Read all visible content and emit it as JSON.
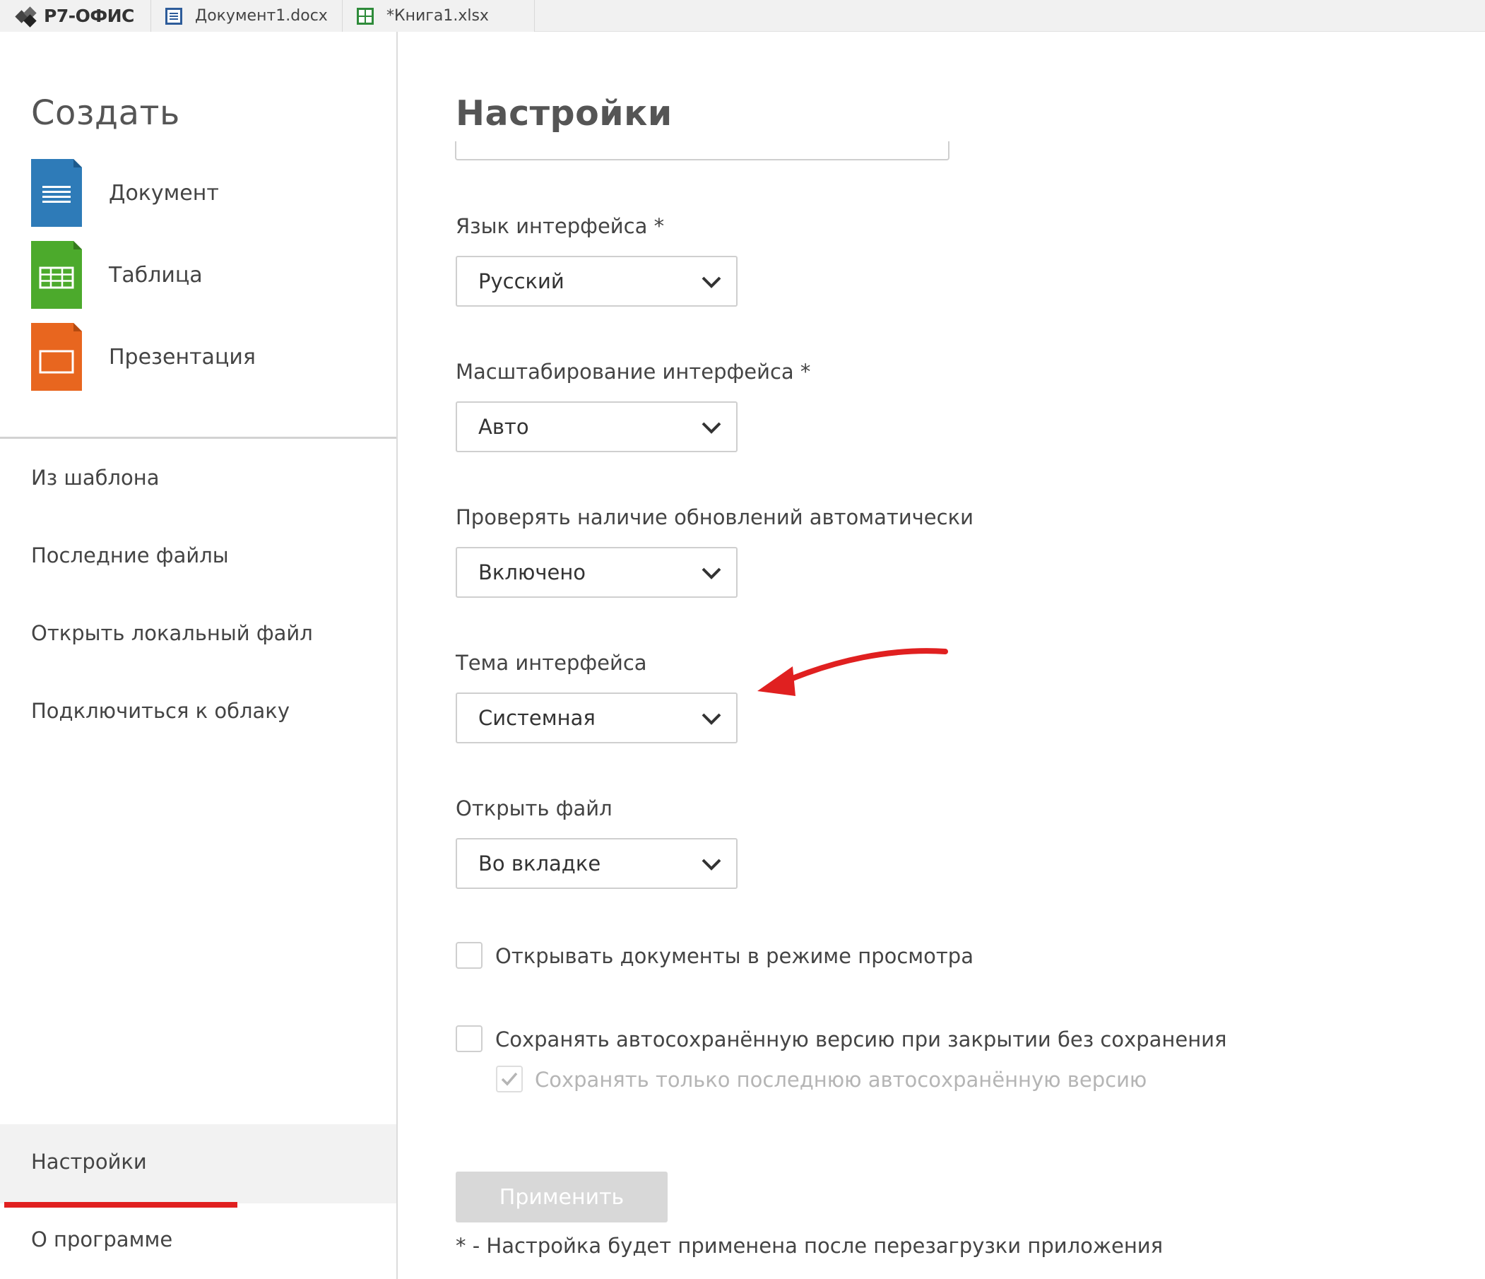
{
  "app": {
    "brand": "Р7-ОФИС"
  },
  "tabs": [
    {
      "label": "Документ1.docx",
      "icon": "document-icon"
    },
    {
      "label": "*Книга1.xlsx",
      "icon": "spreadsheet-icon"
    }
  ],
  "sidebar": {
    "create_title": "Создать",
    "create_items": [
      {
        "label": "Документ",
        "icon": "document-file-icon",
        "color": "#2e7bb8"
      },
      {
        "label": "Таблица",
        "icon": "spreadsheet-file-icon",
        "color": "#4caa2c"
      },
      {
        "label": "Презентация",
        "icon": "presentation-file-icon",
        "color": "#e8661f"
      }
    ],
    "nav": [
      "Из шаблона",
      "Последние файлы",
      "Открыть локальный файл",
      "Подключиться к облаку"
    ],
    "bottom_nav": {
      "settings": "Настройки",
      "about": "О программе"
    }
  },
  "settings": {
    "title": "Настройки",
    "fields": [
      {
        "label": "Язык интерфейса *",
        "value": "Русский"
      },
      {
        "label": "Масштабирование интерфейса *",
        "value": "Авто"
      },
      {
        "label": "Проверять наличие обновлений автоматически",
        "value": "Включено"
      },
      {
        "label": "Тема интерфейса",
        "value": "Системная"
      },
      {
        "label": "Открыть файл",
        "value": "Во вкладке"
      }
    ],
    "checkboxes": [
      {
        "label": "Открывать документы в режиме просмотра",
        "checked": false,
        "disabled": false
      },
      {
        "label": "Сохранять автосохранённую версию при закрытии без сохранения",
        "checked": false,
        "disabled": false
      },
      {
        "label": "Сохранять только последнюю автосохранённую версию",
        "checked": true,
        "disabled": true
      }
    ],
    "apply_label": "Применить",
    "footnote": "* - Настройка будет применена после перезагрузки приложения"
  },
  "colors": {
    "annotation_red": "#e02020",
    "apply_disabled": "#d8d8d8"
  }
}
